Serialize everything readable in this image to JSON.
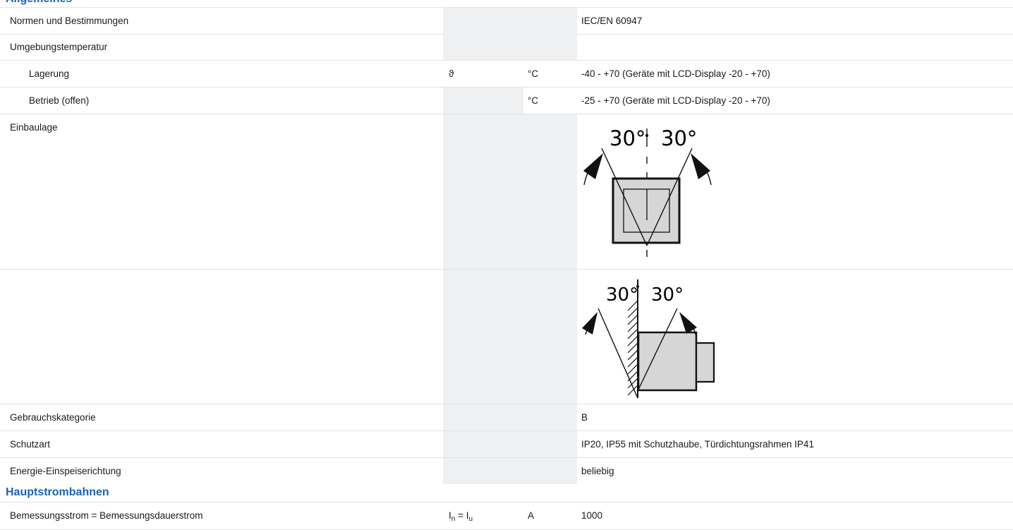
{
  "sections": {
    "general": {
      "title": "Allgemeines",
      "rows": [
        {
          "label": "Normen und Bestimmungen",
          "symbol": "",
          "unit": "",
          "value": "IEC/EN 60947"
        },
        {
          "label": "Umgebungstemperatur",
          "symbol": "",
          "unit": "",
          "value": ""
        },
        {
          "label": "Lagerung",
          "symbol": "ϑ",
          "unit": "°C",
          "value": "-40 - +70 (Geräte mit LCD-Display -20 - +70)"
        },
        {
          "label": "Betrieb (offen)",
          "symbol": "",
          "unit": "°C",
          "value": "-25 - +70 (Geräte mit LCD-Display -20 - +70)"
        },
        {
          "label": "Einbaulage",
          "symbol": "",
          "unit": "",
          "value": "",
          "diagram": {
            "left_angle": "30°",
            "right_angle": "30°"
          }
        },
        {
          "label": "",
          "symbol": "",
          "unit": "",
          "value": "",
          "diagram": {
            "left_angle": "30°",
            "right_angle": "30°"
          }
        },
        {
          "label": "Gebrauchskategorie",
          "symbol": "",
          "unit": "",
          "value": "B"
        },
        {
          "label": "Schutzart",
          "symbol": "",
          "unit": "",
          "value": "IP20, IP55 mit Schutzhaube, Türdichtungsrahmen IP41"
        },
        {
          "label": "Energie-Einspeiserichtung",
          "symbol": "",
          "unit": "",
          "value": "beliebig"
        }
      ]
    },
    "main_circuits": {
      "title": "Hauptstrombahnen",
      "rows": [
        {
          "label": "Bemessungsstrom = Bemessungsdauerstrom",
          "symbol_main": "I",
          "symbol_sub_1": "n",
          "symbol_eq": " = ",
          "symbol_main_2": "I",
          "symbol_sub_2": "u",
          "unit": "A",
          "value": "1000"
        }
      ]
    }
  }
}
